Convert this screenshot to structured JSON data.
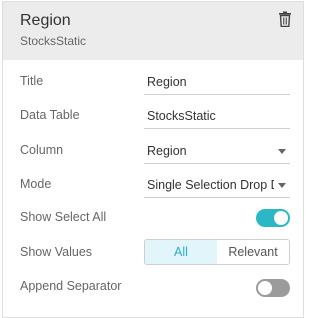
{
  "header": {
    "title": "Region",
    "subtitle": "StocksStatic"
  },
  "fields": {
    "title": {
      "label": "Title",
      "value": "Region"
    },
    "data_table": {
      "label": "Data Table",
      "value": "StocksStatic"
    },
    "column": {
      "label": "Column",
      "value": "Region"
    },
    "mode": {
      "label": "Mode",
      "value": "Single Selection Drop Do"
    },
    "show_select_all": {
      "label": "Show Select All",
      "on": true
    },
    "show_values": {
      "label": "Show Values",
      "options": [
        "All",
        "Relevant"
      ],
      "selected": "All"
    },
    "append_separator": {
      "label": "Append Separator",
      "on": false
    }
  },
  "colors": {
    "accent": "#2ab8c6",
    "toggle_off": "#9b9b9b",
    "header_bg": "#ececec"
  },
  "icons": {
    "delete": "trash-icon",
    "dropdown": "chevron-down-icon"
  }
}
